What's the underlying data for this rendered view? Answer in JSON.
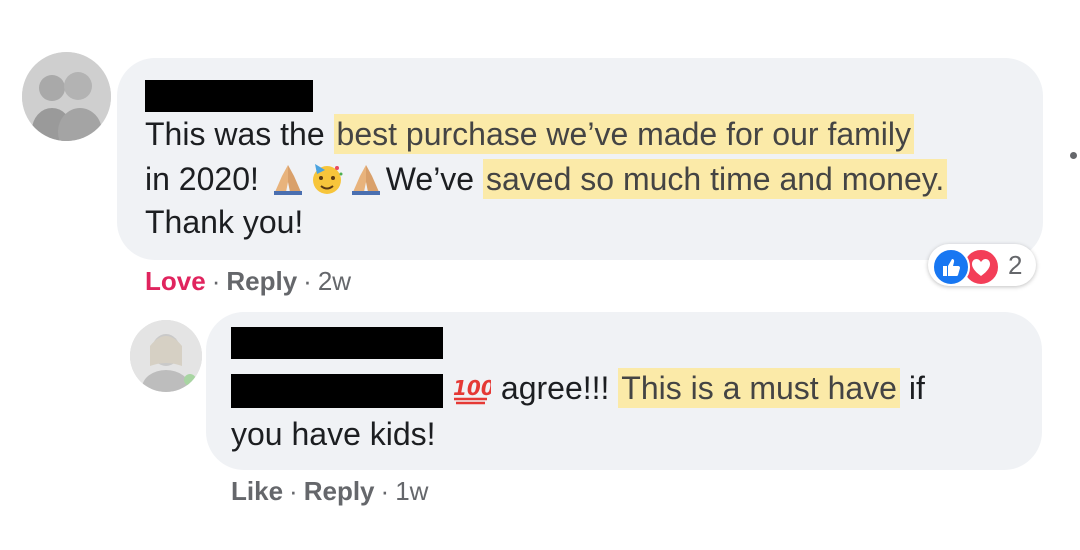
{
  "comment": {
    "text_1": "This was the ",
    "highlight_1": "best purchase we’ve made for our family",
    "text_2": "in 2020! ",
    "text_3": "We’ve ",
    "highlight_2": "saved so much time and money.",
    "text_4": "Thank you!",
    "actions": {
      "love": "Love",
      "reply": "Reply",
      "time": "2w",
      "separator": "·"
    },
    "reactions": {
      "count": "2",
      "icons": [
        "like-icon",
        "love-icon"
      ]
    },
    "emojis": [
      "folded-hands-icon",
      "partying-face-icon",
      "folded-hands-icon"
    ]
  },
  "reply": {
    "emoji": "hundred-points-icon",
    "text_1": " agree!!! ",
    "highlight_1": "This is a must have",
    "text_2": " if",
    "text_3": "you have kids!",
    "actions": {
      "like": "Like",
      "reply": "Reply",
      "time": "1w",
      "separator": "·"
    }
  },
  "colors": {
    "bubble": "#f0f2f5",
    "highlight": "#fbeaa8",
    "love": "#e0245e",
    "like_blue": "#1877f2",
    "love_red": "#f33e58",
    "muted": "#65676b"
  }
}
